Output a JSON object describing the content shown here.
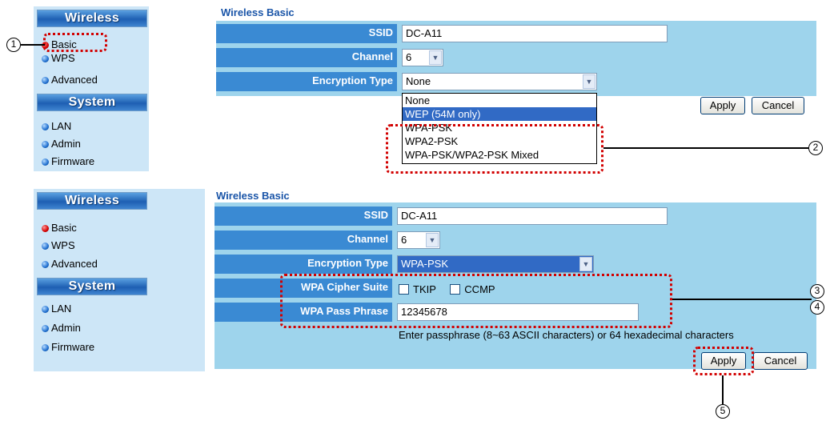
{
  "top": {
    "sidebar": {
      "wireless_header": "Wireless",
      "basic": "Basic",
      "wps": "WPS",
      "advanced": "Advanced",
      "system_header": "System",
      "lan": "LAN",
      "admin": "Admin",
      "firmware": "Firmware"
    },
    "section_title": "Wireless Basic",
    "ssid_label": "SSID",
    "ssid_value": "DC-A11",
    "channel_label": "Channel",
    "channel_value": "6",
    "encryption_label": "Encryption Type",
    "encryption_value": "None",
    "dropdown_options": [
      "None",
      "WEP (54M only)",
      "WPA-PSK",
      "WPA2-PSK",
      "WPA-PSK/WPA2-PSK Mixed"
    ],
    "dropdown_highlighted": "WEP (54M only)",
    "apply": "Apply",
    "cancel": "Cancel"
  },
  "bottom": {
    "sidebar": {
      "wireless_header": "Wireless",
      "basic": "Basic",
      "wps": "WPS",
      "advanced": "Advanced",
      "system_header": "System",
      "lan": "LAN",
      "admin": "Admin",
      "firmware": "Firmware"
    },
    "section_title": "Wireless Basic",
    "ssid_label": "SSID",
    "ssid_value": "DC-A11",
    "channel_label": "Channel",
    "channel_value": "6",
    "encryption_label": "Encryption Type",
    "encryption_value": "WPA-PSK",
    "cipher_label": "WPA Cipher Suite",
    "tkip": "TKIP",
    "ccmp": "CCMP",
    "passphrase_label": "WPA Pass Phrase",
    "passphrase_value": "12345678",
    "hint": "Enter passphrase (8~63 ASCII characters) or 64 hexadecimal characters",
    "apply": "Apply",
    "cancel": "Cancel"
  },
  "callouts": [
    "1",
    "2",
    "3",
    "4",
    "5"
  ],
  "colors": {
    "highlight": "#d20000",
    "label_bg": "#3a8ad3",
    "panel_bg": "#9ed4ec",
    "selection": "#316ac5"
  }
}
